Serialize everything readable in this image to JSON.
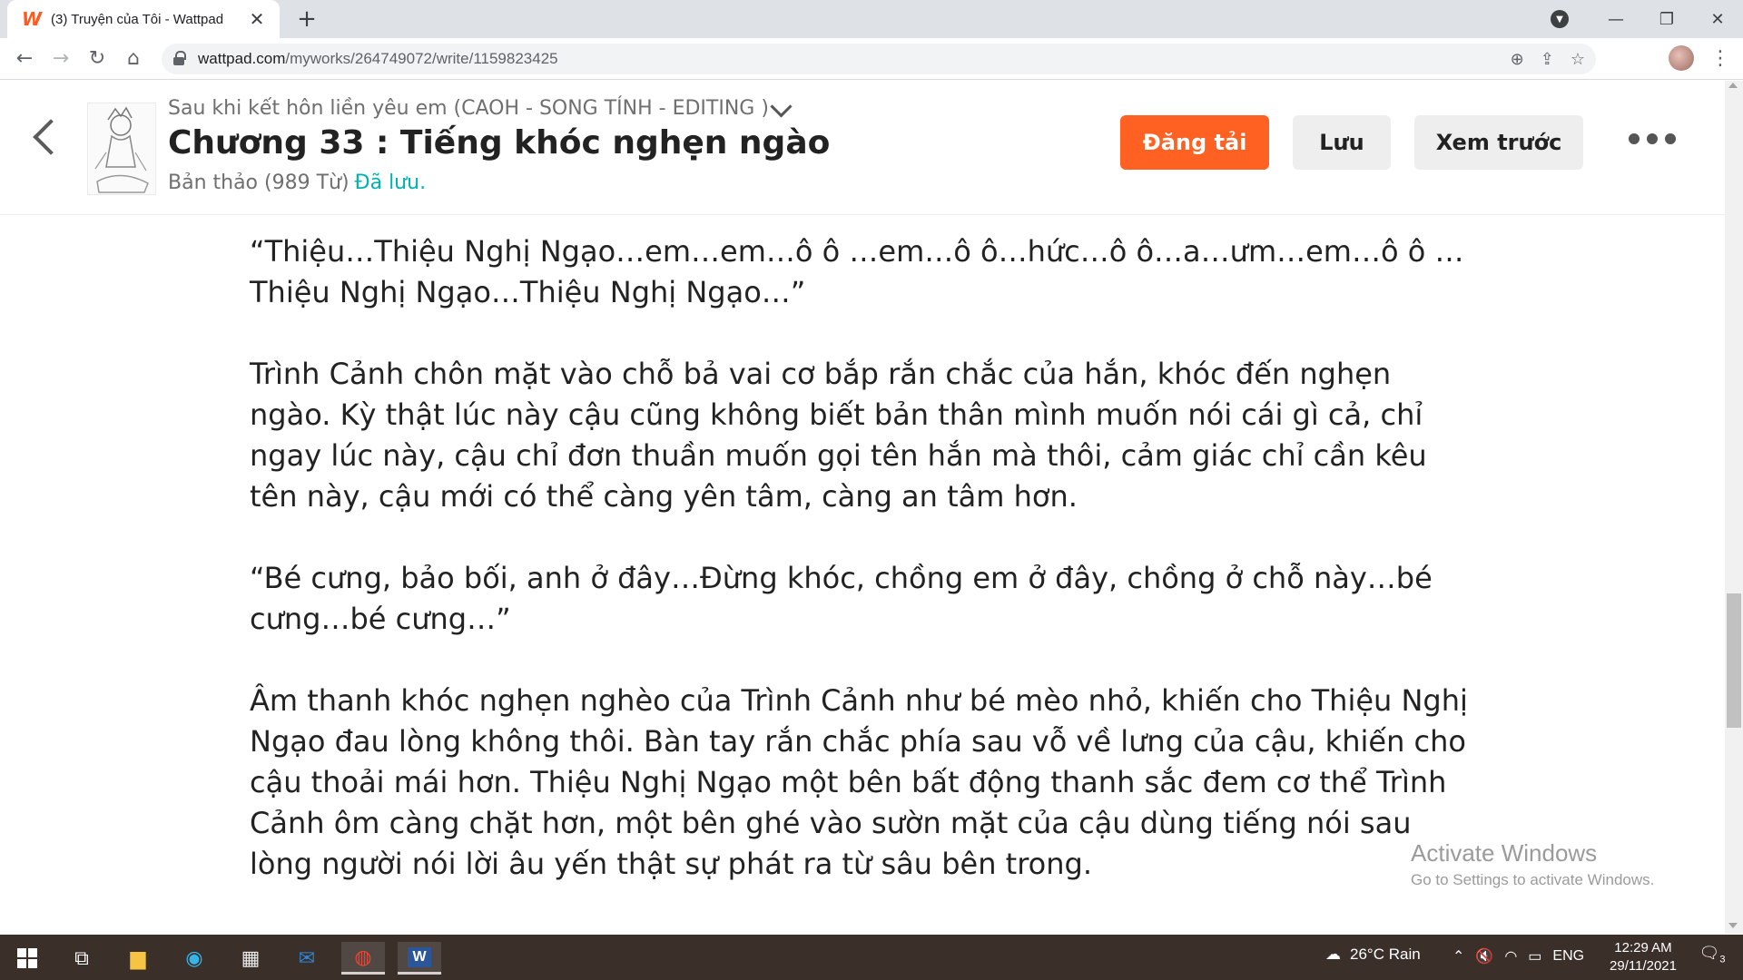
{
  "browser": {
    "tab_title": "(3) Truyện của Tôi - Wattpad",
    "tab_favicon": "W",
    "new_tab_symbol": "+",
    "close_symbol": "✕",
    "url_domain": "wattpad.com",
    "url_path": "/myworks/264749072/write/1159823425"
  },
  "editor": {
    "story_title": "Sau khi kết hôn liền yêu em (CAOH - SONG TÍNH - EDITING )",
    "chapter_title": "Chương 33 : Tiếng khóc nghẹn ngào",
    "draft_status": "Bản thảo (989 Từ)",
    "saved_status": "Đã lưu.",
    "publish_label": "Đăng tải",
    "save_label": "Lưu",
    "preview_label": "Xem trước"
  },
  "content": {
    "paragraphs": [
      "“Thiệu…Thiệu Nghị Ngạo…em…em…ô ô …em…ô ô…hức…ô ô…a…ưm…em…ô ô …Thiệu Nghị Ngạo…Thiệu Nghị Ngạo…”",
      "Trình Cảnh chôn mặt vào chỗ bả vai cơ bắp rắn chắc của hắn, khóc đến nghẹn ngào. Kỳ thật lúc này cậu cũng không biết bản thân mình muốn nói cái gì cả, chỉ ngay lúc này, cậu chỉ đơn thuần muốn gọi tên hắn mà thôi, cảm giác chỉ cần kêu tên này, cậu mới có thể càng yên tâm, càng an tâm hơn.",
      "“Bé cưng, bảo bối, anh ở đây…Đừng khóc, chồng em ở đây, chồng ở chỗ này…bé cưng…bé cưng…”",
      "Âm thanh khóc nghẹn nghèo của Trình Cảnh như bé mèo nhỏ, khiến cho Thiệu Nghị Ngạo đau lòng không thôi. Bàn tay rắn chắc phía sau vỗ về lưng của cậu, khiến cho cậu thoải mái hơn. Thiệu Nghị Ngạo một bên bất động thanh sắc đem cơ thể Trình Cảnh ôm càng chặt hơn, một bên ghé vào sườn mặt của cậu dùng tiếng nói sau lòng người nói lời âu yến thật sự phát ra từ sâu bên trong."
    ]
  },
  "watermark": {
    "line1": "Activate Windows",
    "line2": "Go to Settings to activate Windows."
  },
  "taskbar": {
    "weather": "26°C  Rain",
    "language": "ENG",
    "time": "12:29 AM",
    "date": "29/11/2021",
    "notification_count": "3"
  },
  "colors": {
    "accent": "#ff6122",
    "saved": "#00b2b2",
    "taskbar": "#3b2f2a"
  }
}
